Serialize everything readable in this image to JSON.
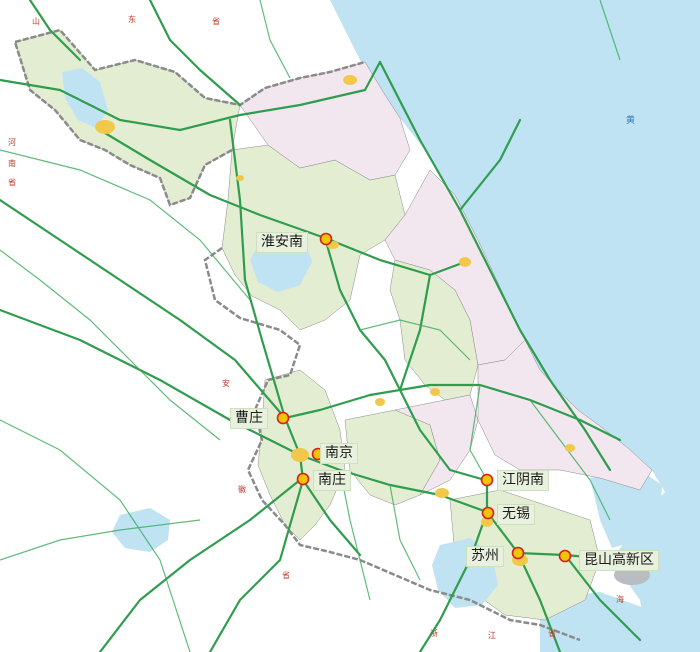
{
  "map": {
    "colors": {
      "sea": "#bfe3f2",
      "land": "#ffffff",
      "green_region": "#e3edd2",
      "pink_region": "#f2e6ef",
      "road": "#2f9d4e",
      "road_thin": "#3aaa5a",
      "boundary": "#8a8a8a",
      "station_fill": "#f3c400",
      "station_stroke": "#d12020",
      "city": "#f2c84b",
      "lake": "#bfe3f2"
    },
    "stations": [
      {
        "name": "淮安南",
        "icon": "station-marker-icon"
      },
      {
        "name": "曹庄",
        "icon": "station-marker-icon"
      },
      {
        "name": "南京",
        "icon": "station-marker-icon"
      },
      {
        "name": "南庄",
        "icon": "station-marker-icon"
      },
      {
        "name": "江阴南",
        "icon": "station-marker-icon"
      },
      {
        "name": "无锡",
        "icon": "station-marker-icon"
      },
      {
        "name": "苏州",
        "icon": "station-marker-icon"
      },
      {
        "name": "昆山高新区",
        "icon": "station-marker-icon"
      }
    ],
    "province_labels": {
      "shandong": [
        "山",
        "东",
        "省"
      ],
      "henan": [
        "河",
        "南",
        "省"
      ],
      "anhui": [
        "安",
        "徽",
        "省"
      ],
      "zhejiang": [
        "浙",
        "江",
        "省"
      ],
      "shanghai": "海"
    },
    "sea_label": "黄"
  }
}
